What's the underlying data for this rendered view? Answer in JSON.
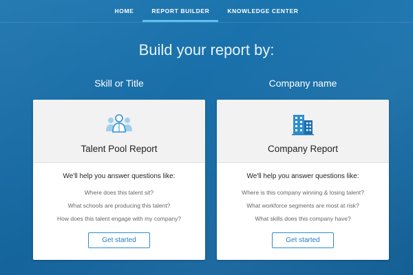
{
  "nav": {
    "items": [
      {
        "label": "HOME",
        "active": false
      },
      {
        "label": "REPORT BUILDER",
        "active": true
      },
      {
        "label": "KNOWLEDGE CENTER",
        "active": false
      }
    ]
  },
  "heading": "Build your report by:",
  "columns": [
    {
      "title": "Skill or Title",
      "card": {
        "icon": "people-group-icon",
        "title": "Talent Pool Report",
        "lead": "We'll help you answer questions like:",
        "questions": [
          "Where does this talent sit?",
          "What schools are producing this talent?",
          "How does this talent engage with my company?"
        ],
        "button": "Get started"
      }
    },
    {
      "title": "Company name",
      "card": {
        "icon": "office-building-icon",
        "title": "Company Report",
        "lead": "We'll help you answer questions like:",
        "questions": [
          "Where is this company winning & losing talent?",
          "What workforce segments are most at risk?",
          "What skills does this company have?"
        ],
        "button": "Get started"
      }
    }
  ],
  "colors": {
    "background": "#1a6fa8",
    "accent": "#5fc0ef",
    "button_border": "#2a8ccc",
    "icon_blue": "#2e8fd0"
  }
}
